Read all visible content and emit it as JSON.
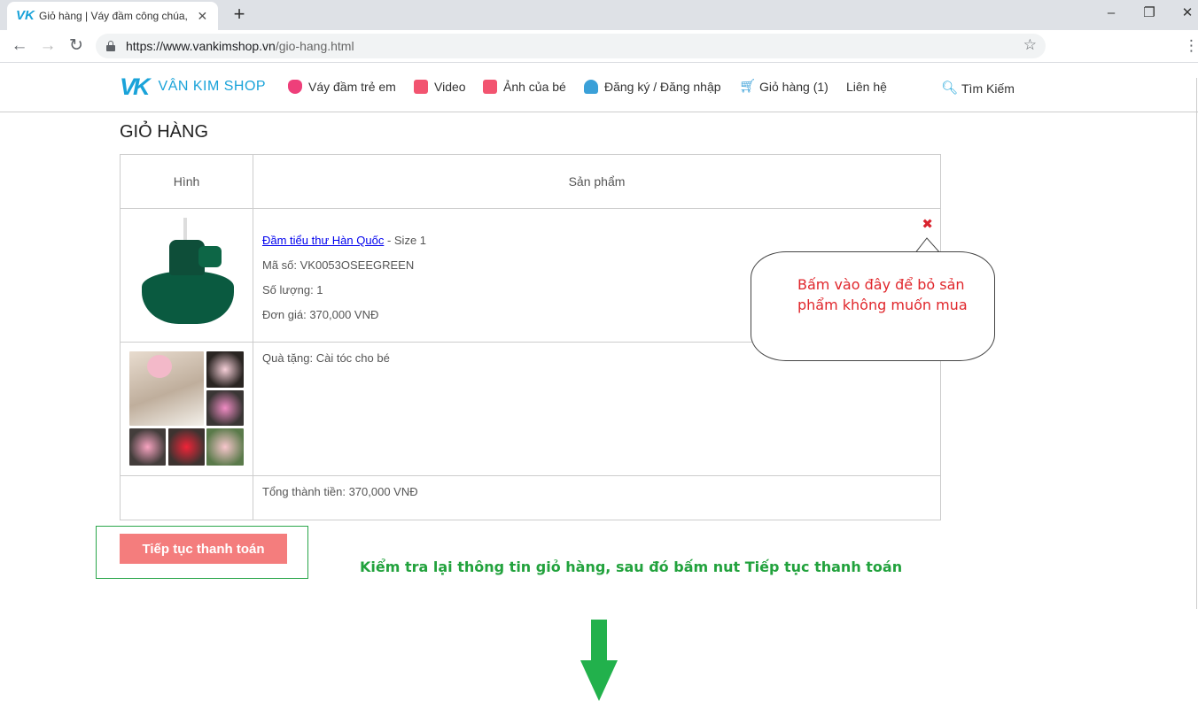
{
  "browser": {
    "tab_title": "Giỏ hàng | Váy đầm công chúa, v",
    "favicon_text": "VK",
    "url_host": "https://www.vankimshop.vn",
    "url_path": "/gio-hang.html",
    "icons": [
      "back-arrow-icon",
      "forward-arrow-icon",
      "reload-icon",
      "lock-icon",
      "star-icon",
      "menu-dots-icon"
    ]
  },
  "site": {
    "logo_mark": "VK",
    "logo_text": "VÂN KIM SHOP",
    "accent_color": "#1aa3d9",
    "nav": [
      {
        "label": "Váy đầm trẻ em",
        "icon": "dress-icon"
      },
      {
        "label": "Video",
        "icon": "camera-icon"
      },
      {
        "label": "Ảnh của bé",
        "icon": "camera-icon"
      },
      {
        "label": "Đăng ký / Đăng nhập",
        "icon": "user-icon"
      },
      {
        "label": "Giỏ hàng (1)",
        "icon": "cart-icon"
      },
      {
        "label": "Liên hệ",
        "icon": ""
      }
    ],
    "search_label": "Tìm Kiếm"
  },
  "cart": {
    "title": "GIỎ HÀNG",
    "headers": {
      "image": "Hình",
      "product": "Sản phẩm"
    },
    "item": {
      "name": "Đầm tiểu thư Hàn Quốc",
      "size": " - Size 1",
      "sku": "Mã số: VK0053OSEEGREEN",
      "qty": "Số lượng: 1",
      "price": "Đơn giá: 370,000 VNĐ",
      "remove_symbol": "✖"
    },
    "gift": "Quà tặng: Cài tóc cho bé",
    "total": "Tổng thành tiền: 370,000 VNĐ"
  },
  "annotations": {
    "callout": "Bấm vào đây để bỏ sản phẩm không muốn mua",
    "instruction": "Kiểm tra lại thông tin giỏ hàng, sau đó bấm nut Tiếp tục thanh toán",
    "callout_color": "#e0262b",
    "instruction_color": "#22a23d"
  },
  "checkout": {
    "button_label": "Tiếp tục thanh toán",
    "button_color": "#f47d7d"
  }
}
